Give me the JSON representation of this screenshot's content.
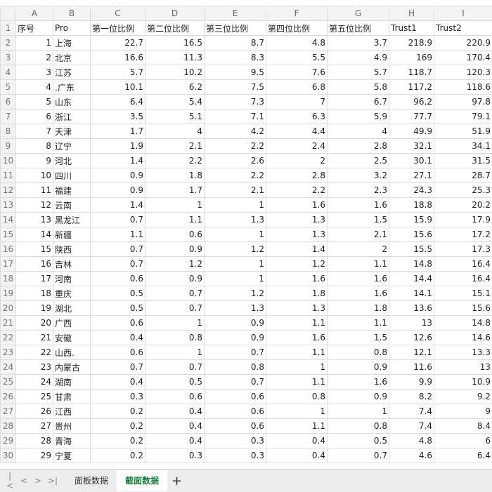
{
  "columns": [
    "A",
    "B",
    "C",
    "D",
    "E",
    "F",
    "G",
    "H",
    "I"
  ],
  "header": [
    "序号",
    "Pro",
    "第一位比例",
    "第二位比例",
    "第三位比例",
    "第四位比例",
    "第五位比例",
    "Trust1",
    "Trust2"
  ],
  "rows": [
    [
      "1",
      "上海",
      "22.7",
      "16.5",
      "8.7",
      "4.8",
      "3.7",
      "218.9",
      "220.9"
    ],
    [
      "2",
      "北京",
      "16.6",
      "11.3",
      "8.3",
      "5.5",
      "4.9",
      "169",
      "170.4"
    ],
    [
      "3",
      "江苏",
      "5.7",
      "10.2",
      "9.5",
      "7.6",
      "5.7",
      "118.7",
      "120.3"
    ],
    [
      "4",
      ".广东",
      "10.1",
      "6.2",
      "7.5",
      "6.8",
      "5.8",
      "117.2",
      "118.6"
    ],
    [
      "5",
      "山东",
      "6.4",
      "5.4",
      "7.3",
      "7",
      "6.7",
      "96.2",
      "97.8"
    ],
    [
      "6",
      "浙江",
      "3.5",
      "5.1",
      "7.1",
      "6.3",
      "5.9",
      "77.7",
      "79.1"
    ],
    [
      "7",
      "天津",
      "1.7",
      "4",
      "4.2",
      "4.4",
      "4",
      "49.9",
      "51.9"
    ],
    [
      "8",
      "辽宁",
      "1.9",
      "2.1",
      "2.2",
      "2.4",
      "2.8",
      "32.1",
      "34.1"
    ],
    [
      "9",
      "河北",
      "1.4",
      "2.2",
      "2.6",
      "2",
      "2.5",
      "30.1",
      "31.5"
    ],
    [
      "10",
      "四川",
      "0.9",
      "1.8",
      "2.2",
      "2.8",
      "3.2",
      "27.1",
      "28.7"
    ],
    [
      "11",
      "福建",
      "0.9",
      "1.7",
      "2.1",
      "2.2",
      "2.3",
      "24.3",
      "25.3"
    ],
    [
      "12",
      "云南",
      "1.4",
      "1",
      "1",
      "1.6",
      "1.6",
      "18.8",
      "20.2"
    ],
    [
      "13",
      "黑龙江",
      "0.7",
      "1.1",
      "1.3",
      "1.3",
      "1.5",
      "15.9",
      "17.9"
    ],
    [
      "14",
      "新疆",
      "1.1",
      "0.6",
      "1",
      "1.3",
      "2.1",
      "15.6",
      "17.2"
    ],
    [
      "15",
      "陕西",
      "0.7",
      "0.9",
      "1.2",
      "1.4",
      "2",
      "15.5",
      "17.3"
    ],
    [
      "16",
      "吉林",
      "0.7",
      "1.2",
      "1",
      "1.2",
      "1.1",
      "14.8",
      "16.4"
    ],
    [
      "17",
      "河南",
      "0.6",
      "0.9",
      "1",
      "1.6",
      "1.6",
      "14.4",
      "16.4"
    ],
    [
      "18",
      "重庆",
      "0.5",
      "0.7",
      "1.2",
      "1.8",
      "1.6",
      "14.1",
      "15.1"
    ],
    [
      "19",
      "湖北",
      "0.5",
      "0.7",
      "1.3",
      "1.3",
      "1.8",
      "13.6",
      "15.6"
    ],
    [
      "20",
      "广西",
      "0.6",
      "1",
      "0.9",
      "1.1",
      "1.1",
      "13",
      "14.8"
    ],
    [
      "21",
      "安徽",
      "0.4",
      "0.8",
      "0.9",
      "1.6",
      "1.5",
      "12.6",
      "14.6"
    ],
    [
      "22",
      "山西.",
      "0.6",
      "1",
      "0.7",
      "1.1",
      "0.8",
      "12.1",
      "13.3"
    ],
    [
      "23",
      "内蒙古",
      "0.7",
      "0.7",
      "0.8",
      "1",
      "0.9",
      "11.6",
      "13"
    ],
    [
      "24",
      "湖南",
      "0.4",
      "0.5",
      "0.7",
      "1.1",
      "1.6",
      "9.9",
      "10.9"
    ],
    [
      "25",
      "甘肃",
      "0.3",
      "0.6",
      "0.6",
      "0.8",
      "0.9",
      "8.2",
      "9.2"
    ],
    [
      "26",
      "江西",
      "0.2",
      "0.4",
      "0.6",
      "1",
      "1",
      "7.4",
      "9"
    ],
    [
      "27",
      "贵州",
      "0.2",
      "0.4",
      "0.6",
      "1.1",
      "0.8",
      "7.4",
      "8.4"
    ],
    [
      "28",
      "青海",
      "0.2",
      "0.4",
      "0.3",
      "0.4",
      "0.5",
      "4.8",
      "6"
    ],
    [
      "29",
      "宁夏",
      "0.2",
      "0.3",
      "0.3",
      "0.4",
      "0.7",
      "4.6",
      "6.4"
    ]
  ],
  "sheet_tabs": {
    "nav": [
      "|<",
      "<",
      ">",
      ">|"
    ],
    "tabs": [
      "面板数据",
      "截面数据"
    ],
    "active": "截面数据",
    "add": "+"
  }
}
